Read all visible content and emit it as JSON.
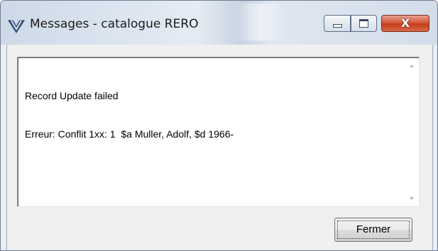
{
  "window": {
    "title": "Messages - catalogue RERO",
    "app_icon": "rero-app-icon",
    "controls": {
      "minimize_icon": "minimize-icon",
      "maximize_icon": "maximize-icon",
      "close_glyph": "X"
    }
  },
  "message": {
    "lines": [
      "Record Update failed",
      "Erreur: Conflit 1xx: 1  $a Muller, Adolf, $d 1966-"
    ]
  },
  "buttons": {
    "close_label": "Fermer"
  },
  "colors": {
    "close_button_red": "#c33d1c",
    "window_border": "#6f7c8e"
  }
}
